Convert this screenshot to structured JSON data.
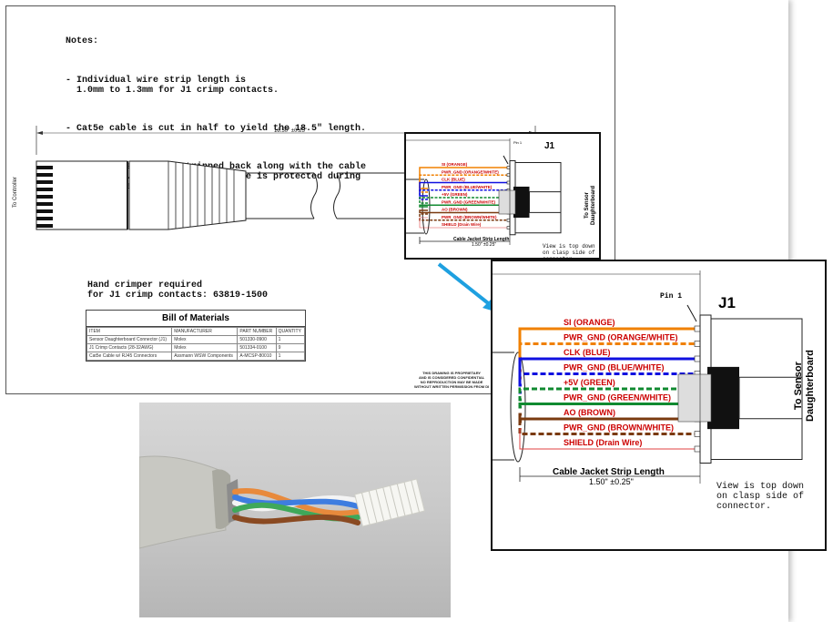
{
  "notes": {
    "heading": "Notes:",
    "items": [
      "- Individual wire strip length is\n  1.0mm to 1.3mm for J1 crimp contacts.",
      "- Cat5e cable is cut in half to yield the 18.5\" length.",
      "- The foil shield is stripped back along with the cable\n  jacketing. Ensure the drain wire is protected during\n  this process."
    ]
  },
  "drawing": {
    "to_controller": "To Controller",
    "length_dim": "18.50\" ±0.25\"",
    "crimper_note": "Hand crimper required\nfor J1 crimp contacts: 63819-1500",
    "proprietary_lines": [
      "THIS DRAWING IS PROPRIETARY",
      "AND IS CONSIDERED CONFIDENTIAL",
      "NO REPRODUCTION MAY BE MADE",
      "WITHOUT WRITTEN PERMISSION FROM DI"
    ]
  },
  "bom": {
    "title": "Bill of Materials",
    "headers": [
      "ITEM",
      "MANUFACTURER",
      "PART NUMBER",
      "QUANTITY"
    ],
    "rows": [
      [
        "Sensor Daughterboard Connector (J1)",
        "Molex",
        "501330-0900",
        "1"
      ],
      [
        "J1 Crimp Contacts (28-32AWG)",
        "Molex",
        "501334-0100",
        "9"
      ],
      [
        "Cat5e Cable w/ RJ45 Connectors",
        "Assmann WSW Components",
        "A-MCSP-80010",
        "1"
      ]
    ]
  },
  "connector": {
    "label": "J1",
    "pin1": "Pin 1",
    "to_sensor": [
      "To Sensor",
      "Daughterboard"
    ],
    "strip_length_label": "Cable Jacket Strip Length",
    "strip_length_dim": "1.50\" ±0.25\"",
    "view_note": "View is top down\non clasp side of\nconnector.",
    "wires": [
      {
        "label": "SI (ORANGE)",
        "color": "#f08000",
        "style": "solid"
      },
      {
        "label": "PWR_GND (ORANGE/WHITE)",
        "color": "#f08000",
        "style": "dashed"
      },
      {
        "label": "CLK (BLUE)",
        "color": "#1010e0",
        "style": "solid"
      },
      {
        "label": "PWR_GND (BLUE/WHITE)",
        "color": "#1010e0",
        "style": "dashed"
      },
      {
        "label": "+5V (GREEN)",
        "color": "#108a30",
        "style": "dashed"
      },
      {
        "label": "PWR_GND (GREEN/WHITE)",
        "color": "#108a30",
        "style": "solid"
      },
      {
        "label": "AO (BROWN)",
        "color": "#7a3a10",
        "style": "solid"
      },
      {
        "label": "PWR_GND (BROWN/WHITE)",
        "color": "#7a3a10",
        "style": "dashed"
      },
      {
        "label": "SHIELD (Drain Wire)",
        "color": "#e04040",
        "style": "thin"
      }
    ],
    "label_color": "#cc0000"
  },
  "colors": {
    "callout_arrow": "#1ea0e0",
    "frame": "#555555"
  }
}
